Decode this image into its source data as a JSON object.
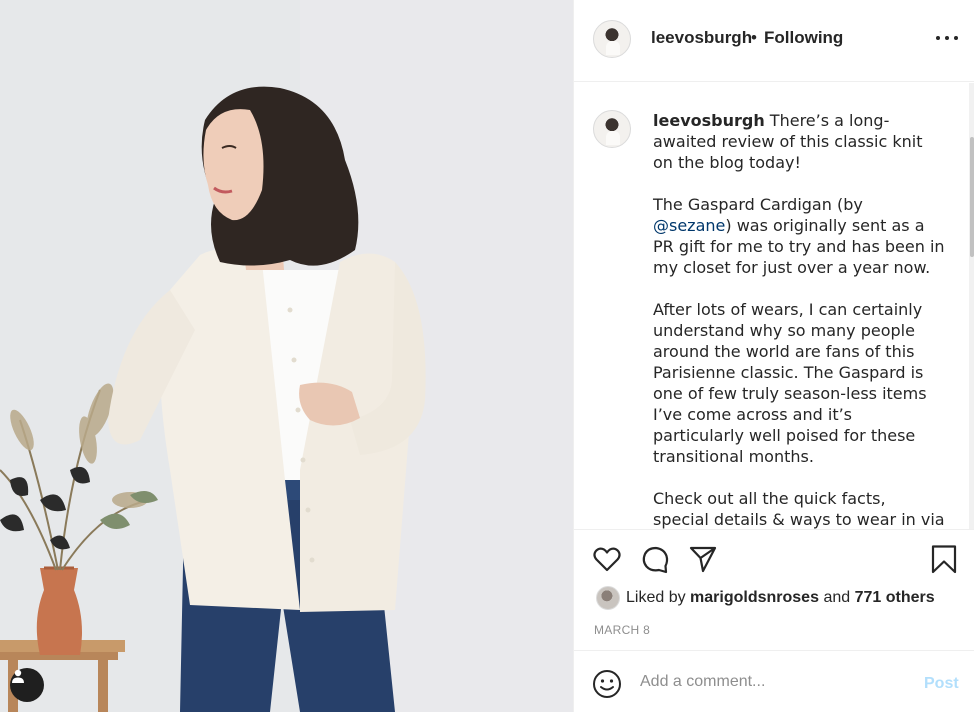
{
  "post": {
    "username": "leevosburgh",
    "separator": "•",
    "follow_status": "Following",
    "more_icon": "more-horizontal-icon"
  },
  "caption": {
    "username": "leevosburgh",
    "text_before_mention": " There’s a long-awaited review of this classic knit on the blog today!\n\nThe Gaspard Cardigan (by ",
    "mention": "@sezane",
    "text_after_mention": ") was originally sent as a PR gift for me to try and has been in my closet for just over a year now.\n\nAfter lots of wears, I can certainly understand why so many people around the world are fans of this Parisienne classic. The Gaspard is one of few truly season-less items I’ve come across and it’s particularly well poised for these transitional months.\n\nCheck out all the quick facts, special details & ways to wear in via the link in my bio!"
  },
  "actions": {
    "like_icon": "heart-icon",
    "comment_icon": "comment-icon",
    "share_icon": "send-icon",
    "save_icon": "bookmark-icon"
  },
  "likes": {
    "prefix": "Liked by",
    "user": "marigoldsnroses",
    "joiner": "and",
    "others": "771 others"
  },
  "date": "MARCH 8",
  "comment": {
    "placeholder": "Add a comment...",
    "post_label": "Post",
    "post_color": "#b2dffc",
    "emoji_icon": "smiley-icon"
  },
  "photo": {
    "tag_icon": "user-tag-icon"
  }
}
